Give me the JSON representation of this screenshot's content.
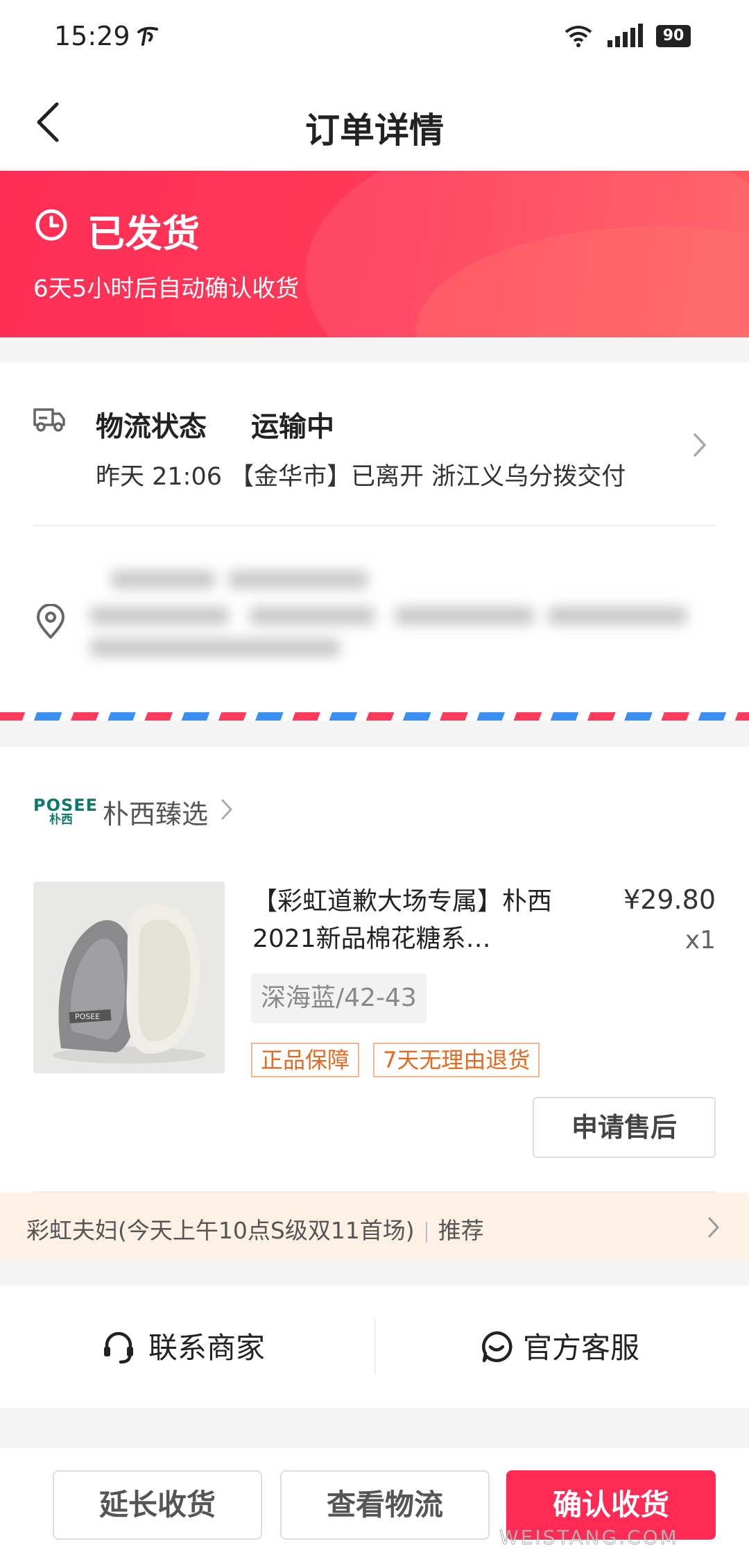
{
  "status_bar": {
    "time": "15:29",
    "battery": "90"
  },
  "navbar": {
    "title": "订单详情"
  },
  "order_status": {
    "title": "已发货",
    "auto_confirm": "6天5小时后自动确认收货"
  },
  "logistics": {
    "label": "物流状态",
    "state": "运输中",
    "latest": "昨天 21:06 【金华市】已离开 浙江义乌分拨交付"
  },
  "shop": {
    "logo_en": "POSEE",
    "logo_cn": "朴西",
    "name": "朴西臻选"
  },
  "product": {
    "title": "【彩虹道歉大场专属】朴西2021新品棉花糖系…",
    "price": "¥29.80",
    "quantity": "x1",
    "spec": "深海蓝/42-43",
    "tags": [
      "正品保障",
      "7天无理由退货"
    ],
    "after_sale_label": "申请售后",
    "image_label": "POSEE"
  },
  "promo": {
    "text": "彩虹夫妇(今天上午10点S级双11首场)",
    "suffix": "推荐"
  },
  "contact": {
    "merchant": "联系商家",
    "service": "官方客服"
  },
  "actions": {
    "extend": "延长收货",
    "track": "查看物流",
    "confirm": "确认收货"
  },
  "watermark": "WEISTANG.COM",
  "colors": {
    "accent": "#ff2b55",
    "tag_orange": "#e66a1e",
    "airmail_red": "#ff3b5c",
    "airmail_blue": "#3a8ff5"
  }
}
